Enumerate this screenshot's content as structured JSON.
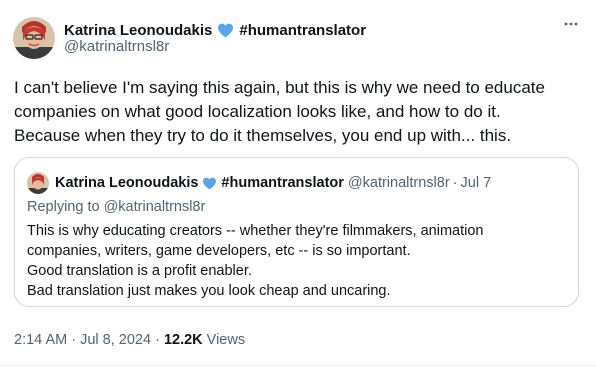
{
  "tweet": {
    "author_name": "Katrina Leonoudakis",
    "author_tag": "#humantranslator",
    "author_handle": "@katrinaltrnsl8r",
    "heart_icon_color": "#5ba4e6",
    "body_lines": [
      "I can't believe I'm saying this again, but this is why we need to educate",
      "companies on what good localization looks like, and how to do it.",
      "Because when they try to do it themselves, you end up with... this."
    ],
    "more_icon": "more-horizontal-icon"
  },
  "quoted": {
    "author_name": "Katrina Leonoudakis",
    "author_tag": "#humantranslator",
    "author_handle": "@katrinaltrnsl8r",
    "separator": "·",
    "date": "Jul 7",
    "replying_prefix": "Replying to ",
    "replying_handle": "@katrinaltrnsl8r",
    "body_lines": [
      "This is why educating creators -- whether they're filmmakers, animation",
      "companies, writers, game developers, etc -- is so important.",
      "Good translation is a profit enabler.",
      "Bad translation just makes you look cheap and uncaring."
    ]
  },
  "meta": {
    "time": "2:14 AM",
    "sep1": " · ",
    "date": "Jul 8, 2024",
    "sep2": " · ",
    "views_count": "12.2K",
    "views_label": " Views"
  }
}
